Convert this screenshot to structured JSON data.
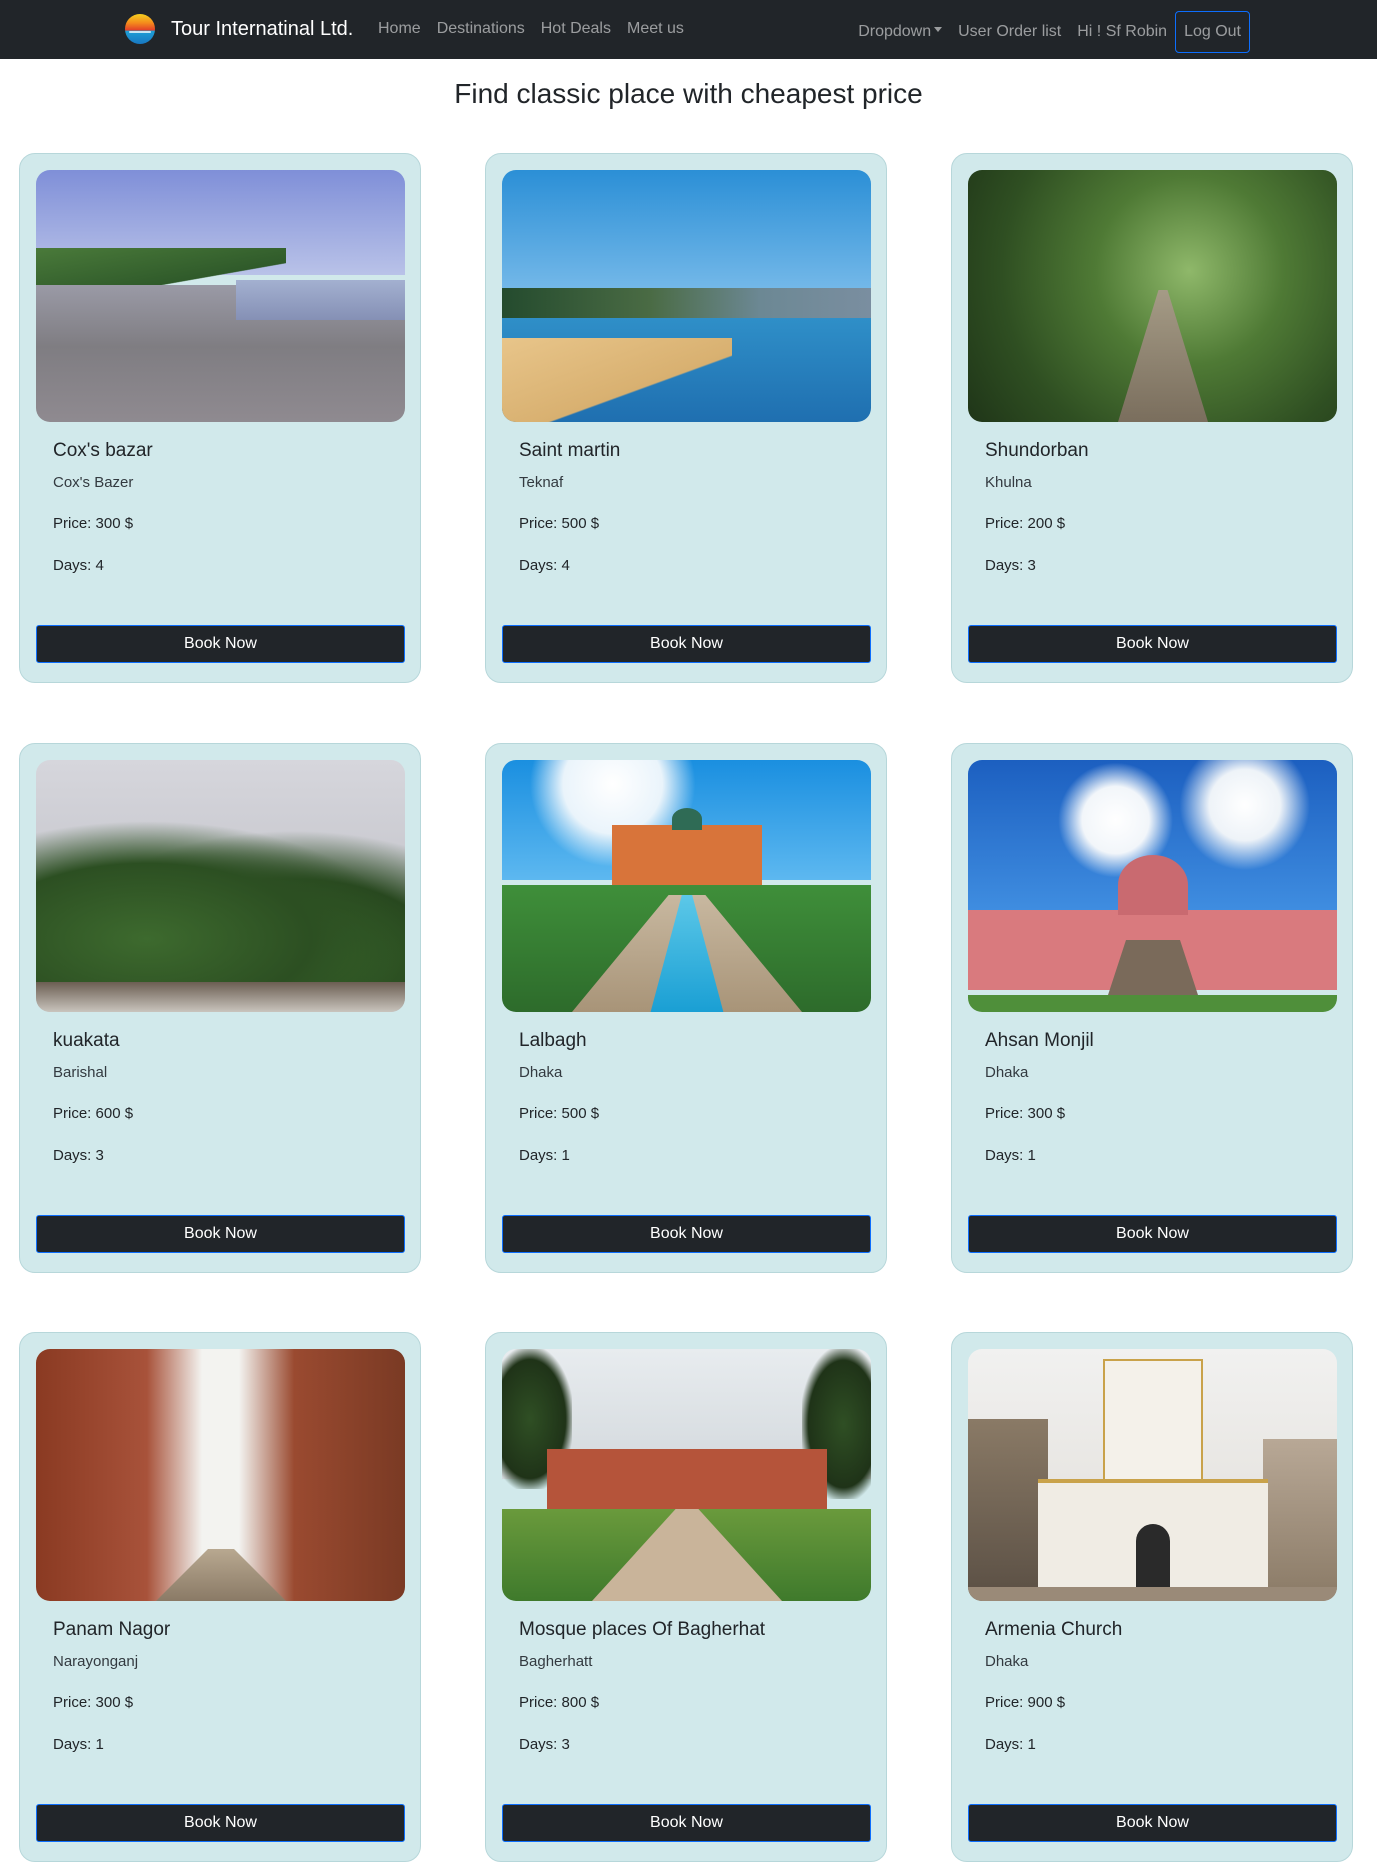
{
  "navbar": {
    "brand": "Tour Internatinal Ltd.",
    "links": [
      "Home",
      "Destinations",
      "Hot Deals",
      "Meet us"
    ],
    "dropdown_label": "Dropdown",
    "order_list_label": "User Order list",
    "greeting": "Hi ! Sf Robin",
    "logout_label": "Log Out"
  },
  "main": {
    "title": "Find classic place with cheapest price",
    "cards": [
      {
        "title": "Cox's bazar",
        "location": "Cox's Bazer",
        "price": "Price: 300 $",
        "days": "Days: 4",
        "button": "Book Now",
        "image": "beach-photo"
      },
      {
        "title": "Saint martin",
        "location": "Teknaf",
        "price": "Price: 500 $",
        "days": "Days: 4",
        "button": "Book Now",
        "image": "island-beach-photo"
      },
      {
        "title": "Shundorban",
        "location": "Khulna",
        "price": "Price: 200 $",
        "days": "Days: 3",
        "button": "Book Now",
        "image": "forest-walkway-photo"
      },
      {
        "title": "kuakata",
        "location": "Barishal",
        "price": "Price: 600 $",
        "days": "Days: 3",
        "button": "Book Now",
        "image": "palm-trees-photo"
      },
      {
        "title": "Lalbagh",
        "location": "Dhaka",
        "price": "Price: 500 $",
        "days": "Days: 1",
        "button": "Book Now",
        "image": "fort-photo"
      },
      {
        "title": "Ahsan Monjil",
        "location": "Dhaka",
        "price": "Price: 300 $",
        "days": "Days: 1",
        "button": "Book Now",
        "image": "pink-palace-photo"
      },
      {
        "title": "Panam Nagor",
        "location": "Narayonganj",
        "price": "Price: 300 $",
        "days": "Days: 1",
        "button": "Book Now",
        "image": "old-city-street-photo"
      },
      {
        "title": "Mosque places Of Bagherhat",
        "location": "Bagherhatt",
        "price": "Price: 800 $",
        "days": "Days: 3",
        "button": "Book Now",
        "image": "mosque-photo"
      },
      {
        "title": "Armenia Church",
        "location": "Dhaka",
        "price": "Price: 900 $",
        "days": "Days: 1",
        "button": "Book Now",
        "image": "church-photo"
      }
    ]
  },
  "colors": {
    "navbar_bg": "#212529",
    "card_bg": "#d1e9eb",
    "button_bg": "#212529",
    "button_border": "#0d6efd"
  }
}
